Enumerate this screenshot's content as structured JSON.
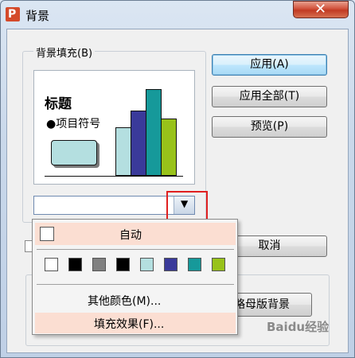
{
  "window": {
    "app_icon": "P",
    "title": "背景",
    "close_glyph": "✕"
  },
  "fill_group": {
    "label": "背景填充(B)"
  },
  "preview": {
    "title": "标题",
    "bullet": "●项目符号",
    "bars": [
      {
        "value": 3,
        "color": "#b4dfe0"
      },
      {
        "value": 4,
        "color": "#3a3a9a"
      },
      {
        "value": 5.3,
        "color": "#16999a"
      },
      {
        "value": 3.5,
        "color": "#98c21a"
      }
    ]
  },
  "combo": {
    "value": "",
    "arrow_glyph": "▼"
  },
  "buttons": {
    "apply": "应用(A)",
    "apply_all": "应用全部(T)",
    "preview": "预览(P)",
    "cancel": "取消",
    "omit_bg": "忽略母版背景"
  },
  "dropdown": {
    "auto_label": "自动",
    "swatches": [
      "#ffffff",
      "#000000",
      "#808080",
      "#000000",
      "#b4dfe0",
      "#3a3a9a",
      "#16999a",
      "#98c21a"
    ],
    "more_colors": "其他颜色(M)...",
    "fill_effects": "填充效果(F)..."
  },
  "colors": {
    "highlight": "#fbded2",
    "annotation": "#e02020"
  },
  "overlay": {
    "watermark": "Baidu经验"
  }
}
